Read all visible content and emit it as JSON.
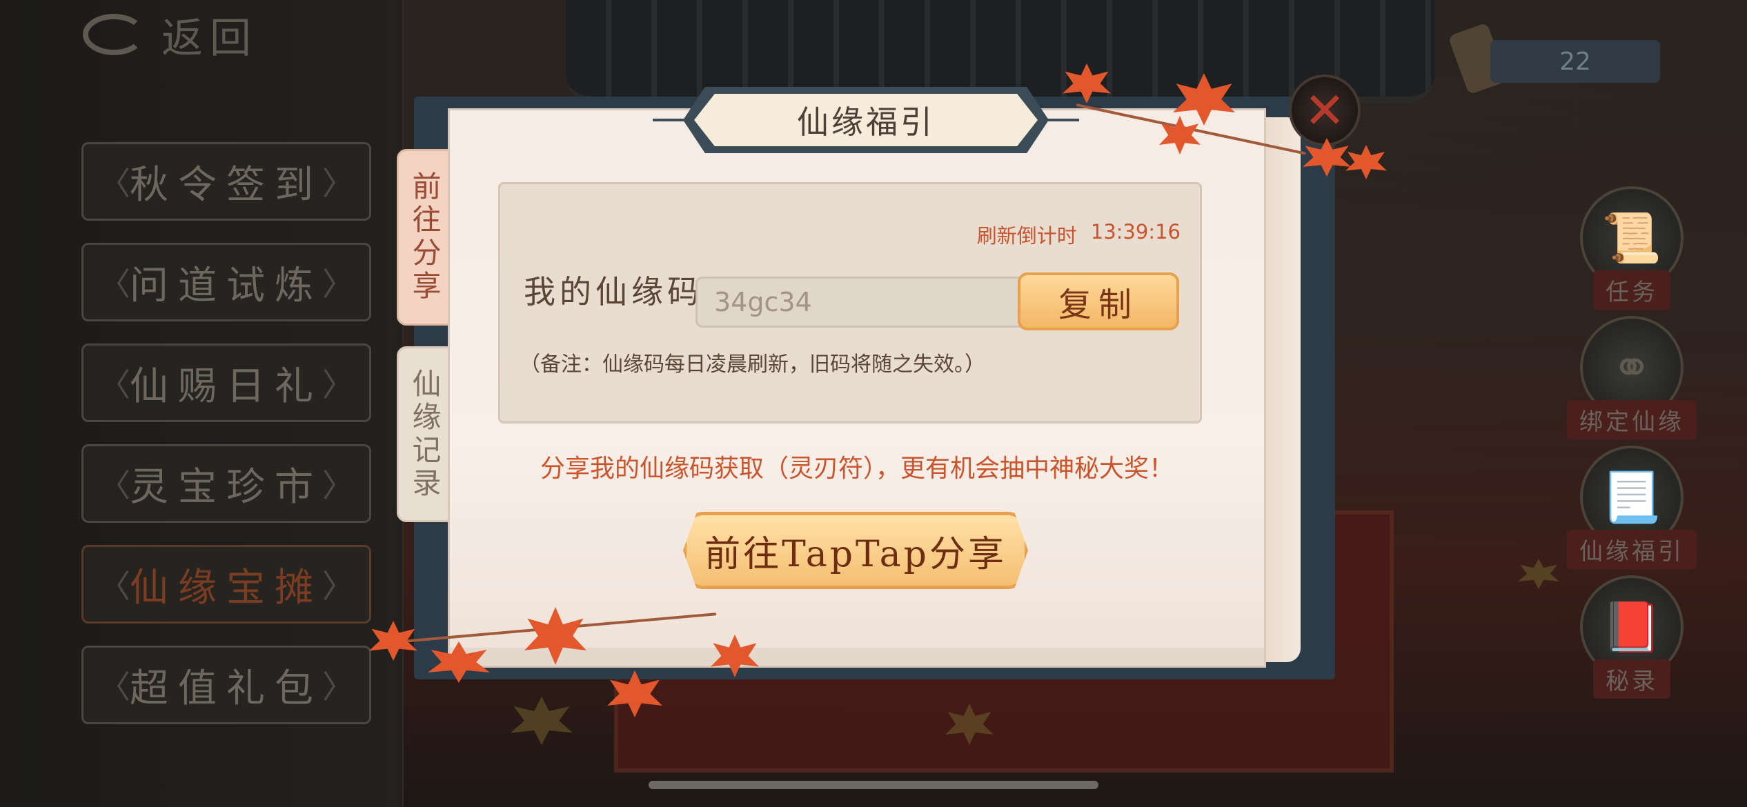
{
  "left_menu": {
    "back_label": "返回",
    "items": [
      {
        "label": "秋令签到"
      },
      {
        "label": "问道试炼"
      },
      {
        "label": "仙赐日礼"
      },
      {
        "label": "灵宝珍市"
      },
      {
        "label": "仙缘宝摊",
        "active": true
      },
      {
        "label": "超值礼包"
      }
    ]
  },
  "currency": {
    "value": "22"
  },
  "right_menu": [
    {
      "label": "任务",
      "icon": "scroll-icon"
    },
    {
      "label": "绑定仙缘",
      "icon": "link-icon"
    },
    {
      "label": "仙缘福引",
      "icon": "scroll-bundle-icon"
    },
    {
      "label": "秘录",
      "icon": "secret-book-icon"
    }
  ],
  "dialog": {
    "title": "仙缘福引",
    "close_icon": "✕",
    "tabs": [
      {
        "label": "前往分享",
        "active": true
      },
      {
        "label": "仙缘记录",
        "active": false
      }
    ],
    "countdown_label": "刷新倒计时",
    "countdown_value": "13:39:16",
    "code_label": "我的仙缘码",
    "code_value": "34gc34",
    "copy_label": "复制",
    "note": "（备注：仙缘码每日凌晨刷新，旧码将随之失效。）",
    "share_text": "分享我的仙缘码获取（灵刃符），更有机会抽中神秘大奖！",
    "share_button": "前往TapTap分享"
  },
  "colors": {
    "accent_orange": "#c9552f",
    "button_gold": "#f5bf72",
    "dialog_bg": "#f8efe8",
    "frame_slate": "#3c4c57"
  }
}
